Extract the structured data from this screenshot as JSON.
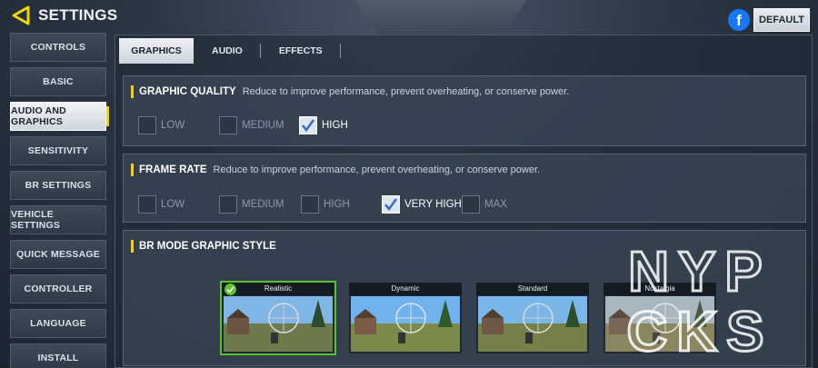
{
  "header": {
    "title": "SETTINGS",
    "default_label": "DEFAULT",
    "facebook_letter": "f"
  },
  "sidebar": {
    "items": [
      {
        "label": "CONTROLS",
        "active": false
      },
      {
        "label": "BASIC",
        "active": false
      },
      {
        "label": "AUDIO AND GRAPHICS",
        "active": true
      },
      {
        "label": "SENSITIVITY",
        "active": false
      },
      {
        "label": "BR SETTINGS",
        "active": false
      },
      {
        "label": "VEHICLE SETTINGS",
        "active": false
      },
      {
        "label": "QUICK MESSAGE",
        "active": false
      },
      {
        "label": "CONTROLLER",
        "active": false
      },
      {
        "label": "LANGUAGE",
        "active": false
      },
      {
        "label": "INSTALL",
        "active": false
      }
    ]
  },
  "tabs": [
    {
      "label": "GRAPHICS",
      "active": true
    },
    {
      "label": "AUDIO",
      "active": false
    },
    {
      "label": "EFFECTS",
      "active": false
    }
  ],
  "graphic_quality": {
    "title": "GRAPHIC QUALITY",
    "description": "Reduce to improve performance, prevent overheating, or conserve power.",
    "options": [
      {
        "label": "LOW",
        "checked": false
      },
      {
        "label": "MEDIUM",
        "checked": false
      },
      {
        "label": "HIGH",
        "checked": true
      }
    ]
  },
  "frame_rate": {
    "title": "FRAME RATE",
    "description": "Reduce to improve performance, prevent overheating, or conserve power.",
    "options": [
      {
        "label": "LOW",
        "checked": false
      },
      {
        "label": "MEDIUM",
        "checked": false
      },
      {
        "label": "HIGH",
        "checked": false
      },
      {
        "label": "VERY HIGH",
        "checked": true
      },
      {
        "label": "MAX",
        "checked": false
      }
    ]
  },
  "br_style": {
    "title": "BR MODE GRAPHIC STYLE",
    "styles": [
      {
        "label": "Realistic",
        "selected": true
      },
      {
        "label": "Dynamic",
        "selected": false
      },
      {
        "label": "Standard",
        "selected": false
      },
      {
        "label": "Nostalgia",
        "selected": false
      }
    ]
  },
  "watermark": {
    "line1": "NYP",
    "line2": "CKS"
  },
  "colors": {
    "accent_yellow": "#f5d20a",
    "selected_green": "#58c32f",
    "facebook_blue": "#1877f2"
  }
}
